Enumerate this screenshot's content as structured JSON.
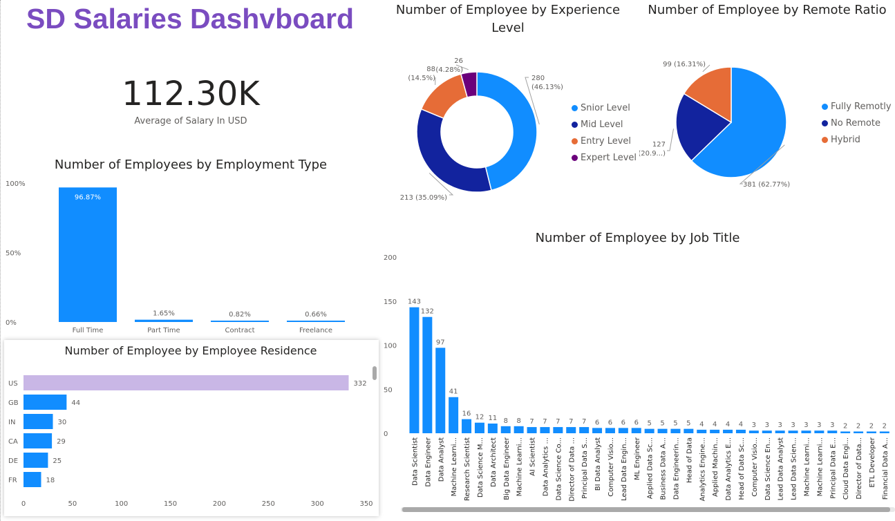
{
  "dashboard": {
    "title": "SD Salaries Dashvboard",
    "kpi_value": "112.30K",
    "kpi_label": "Average of Salary In USD"
  },
  "colors": {
    "title": "#7a4cc0",
    "blue": "#118dff",
    "navy": "#12239e",
    "orange": "#e66c37",
    "purple": "#6b007b",
    "highlight": "#c9b7e6"
  },
  "chart_data": [
    {
      "id": "employment_type",
      "type": "bar",
      "title": "Number of Employees by Employment Type",
      "categories": [
        "Full Time",
        "Part Time",
        "Contract",
        "Freelance"
      ],
      "values": [
        96.87,
        1.65,
        0.82,
        0.66
      ],
      "data_labels": [
        "96.87%",
        "1.65%",
        "0.82%",
        "0.66%"
      ],
      "y_ticks": [
        "0%",
        "50%",
        "100%"
      ],
      "ylim": [
        0,
        100
      ]
    },
    {
      "id": "experience_level",
      "type": "pie",
      "donut": true,
      "title": "Number of Employee by Experience Level",
      "categories": [
        "Snior Level",
        "Mid Level",
        "Entry Level",
        "Expert Level"
      ],
      "values": [
        280,
        213,
        88,
        26
      ],
      "data_labels": [
        [
          "280",
          "(46.13%)"
        ],
        [
          "213 (35.09%)"
        ],
        [
          "88",
          "(14.5%)"
        ],
        [
          "26",
          "(4.28%)"
        ]
      ],
      "colors": [
        "#118dff",
        "#12239e",
        "#e66c37",
        "#6b007b"
      ]
    },
    {
      "id": "remote_ratio",
      "type": "pie",
      "title": "Number of Employee by Remote Ratio",
      "categories": [
        "Fully Remotly",
        "No Remote",
        "Hybrid"
      ],
      "values": [
        381,
        127,
        99
      ],
      "data_labels": [
        [
          "381 (62.77%)"
        ],
        [
          "127",
          "(20.9...)"
        ],
        [
          "99 (16.31%)"
        ]
      ],
      "colors": [
        "#118dff",
        "#12239e",
        "#e66c37"
      ]
    },
    {
      "id": "job_title",
      "type": "bar",
      "title": "Number of Employee by Job Title",
      "categories": [
        "Data Scientist",
        "Data Engineer",
        "Data Analyst",
        "Machine Learni...",
        "Research Scientist",
        "Data Science M...",
        "Data Architect",
        "Big Data Engineer",
        "Machine Learni...",
        "AI Scientist",
        "Data Analytics ...",
        "Data Science Co...",
        "Director of Data ...",
        "Principal Data S...",
        "BI Data Analyst",
        "Computer Visio...",
        "Lead Data Engin...",
        "ML Engineer",
        "Applied Data Sc...",
        "Business Data A...",
        "Data Engineerin...",
        "Head of Data",
        "Analytics Engine...",
        "Applied Machin...",
        "Data Analytics E...",
        "Head of Data Sc...",
        "Computer Visio...",
        "Data Science En...",
        "Lead Data Analyst",
        "Lead Data Scien...",
        "Machine Learni...",
        "Machine Learni...",
        "Principal Data E...",
        "Cloud Data Engi...",
        "Director of Data...",
        "ETL Developer",
        "Financial Data A..."
      ],
      "values": [
        143,
        132,
        97,
        41,
        16,
        12,
        11,
        8,
        8,
        7,
        7,
        7,
        7,
        7,
        6,
        6,
        6,
        6,
        5,
        5,
        5,
        5,
        4,
        4,
        4,
        4,
        3,
        3,
        3,
        3,
        3,
        3,
        3,
        2,
        2,
        2,
        2
      ],
      "y_ticks": [
        "0",
        "50",
        "100",
        "150",
        "200"
      ],
      "ylim": [
        0,
        200
      ]
    },
    {
      "id": "employee_residence",
      "type": "bar",
      "orientation": "horizontal",
      "title": "Number of Employee by Employee Residence",
      "categories": [
        "US",
        "GB",
        "IN",
        "CA",
        "DE",
        "FR"
      ],
      "values": [
        332,
        44,
        30,
        29,
        25,
        18
      ],
      "x_ticks": [
        "0",
        "50",
        "100",
        "150",
        "200",
        "250",
        "300",
        "350"
      ],
      "xlim": [
        0,
        350
      ]
    }
  ]
}
